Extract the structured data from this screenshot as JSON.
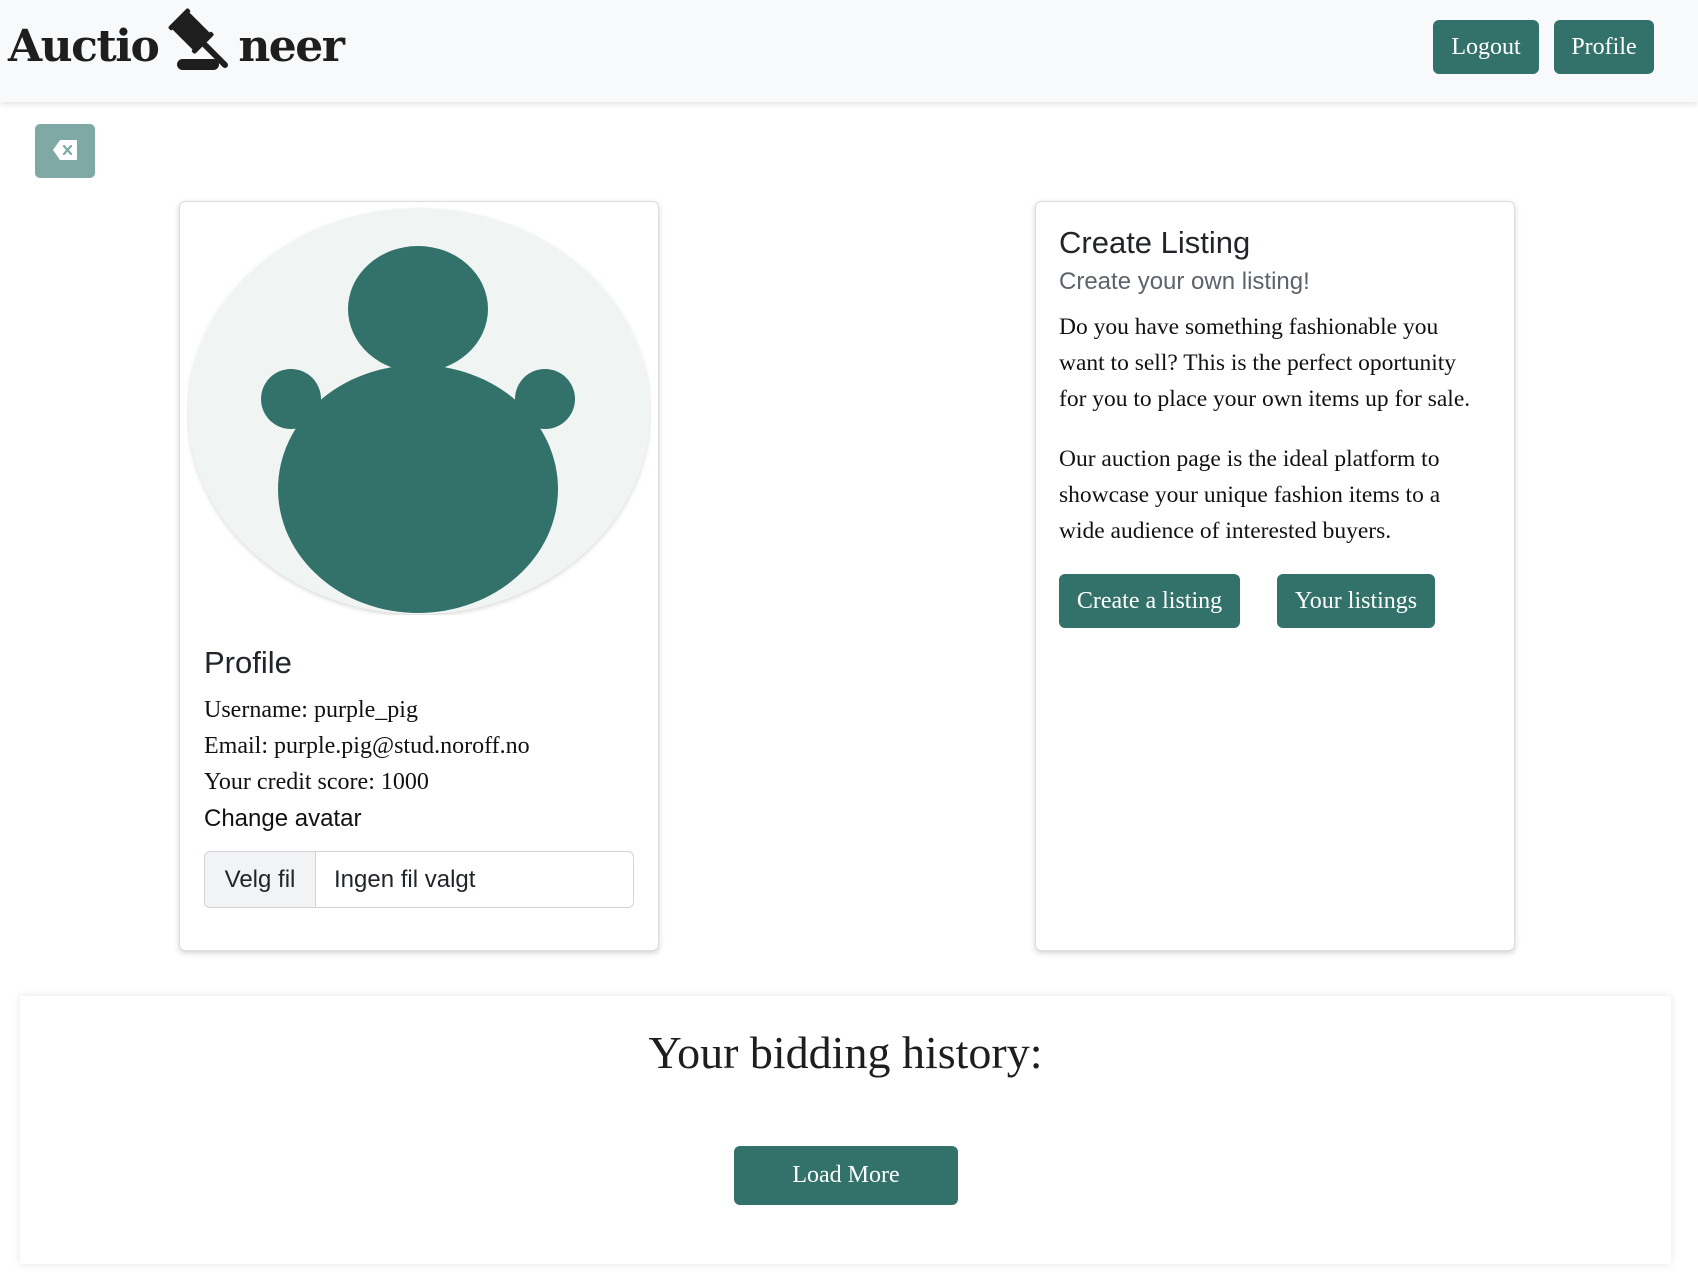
{
  "header": {
    "logo_left": "Auctio",
    "logo_right": "neer",
    "logout_label": "Logout",
    "profile_label": "Profile"
  },
  "profile": {
    "title": "Profile",
    "username": "Username: purple_pig",
    "email": "Email: purple.pig@stud.noroff.no",
    "credit": "Your credit score: 1000",
    "change_avatar_label": "Change avatar",
    "file_button": "Velg fil",
    "file_status": "Ingen fil valgt"
  },
  "listing": {
    "title": "Create Listing",
    "subtitle": "Create your own listing!",
    "paragraph1": "Do you have something fashionable you want to sell? This is the perfect oportunity for you to place your own items up for sale.",
    "paragraph2": "Our auction page is the ideal platform to showcase your unique fashion items to a wide audience of interested buyers.",
    "create_label": "Create a listing",
    "your_label": "Your listings"
  },
  "history": {
    "title": "Your bidding history:",
    "load_more_label": "Load More"
  },
  "icons": {
    "logo": "gavel-icon",
    "back": "backspace-icon",
    "avatar": "default-avatar-icon"
  },
  "colors": {
    "accent": "#33726a",
    "back_button": "#7fa9a4",
    "avatar_bg": "#f0f5f4"
  }
}
